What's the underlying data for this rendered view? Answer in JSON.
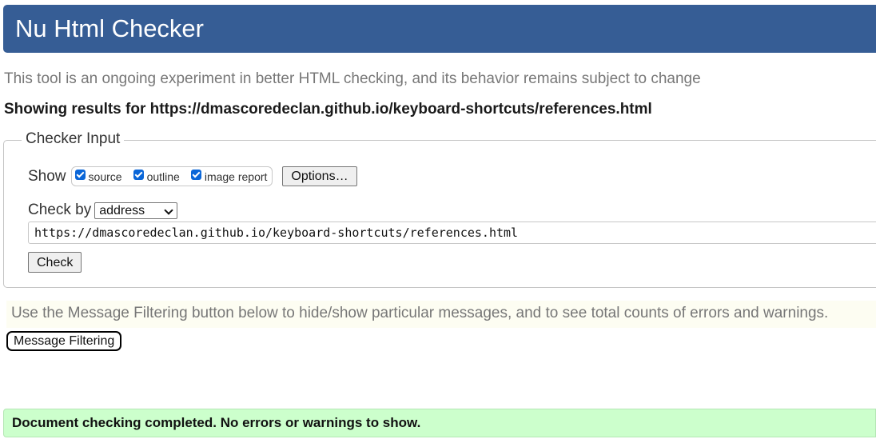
{
  "header": {
    "title": "Nu Html Checker"
  },
  "intro": "This tool is an ongoing experiment in better HTML checking, and its behavior remains subject to change",
  "results_heading": "Showing results for https://dmascoredeclan.github.io/keyboard-shortcuts/references.html",
  "checker_input": {
    "legend": "Checker Input",
    "show_label": "Show",
    "show_options": [
      {
        "label": "source",
        "checked": true
      },
      {
        "label": "outline",
        "checked": true
      },
      {
        "label": "image report",
        "checked": true
      }
    ],
    "options_button": "Options…",
    "check_by_label": "Check by",
    "check_by_value": "address",
    "url_value": "https://dmascoredeclan.github.io/keyboard-shortcuts/references.html",
    "check_button": "Check"
  },
  "filter_note": "Use the Message Filtering button below to hide/show particular messages, and to see total counts of errors and warnings.",
  "filter_button": "Message Filtering",
  "status": "Document checking completed. No errors or warnings to show.",
  "colors": {
    "header": "#365d95",
    "success": "#ccffcc",
    "checkbox": "#0a66d8"
  }
}
